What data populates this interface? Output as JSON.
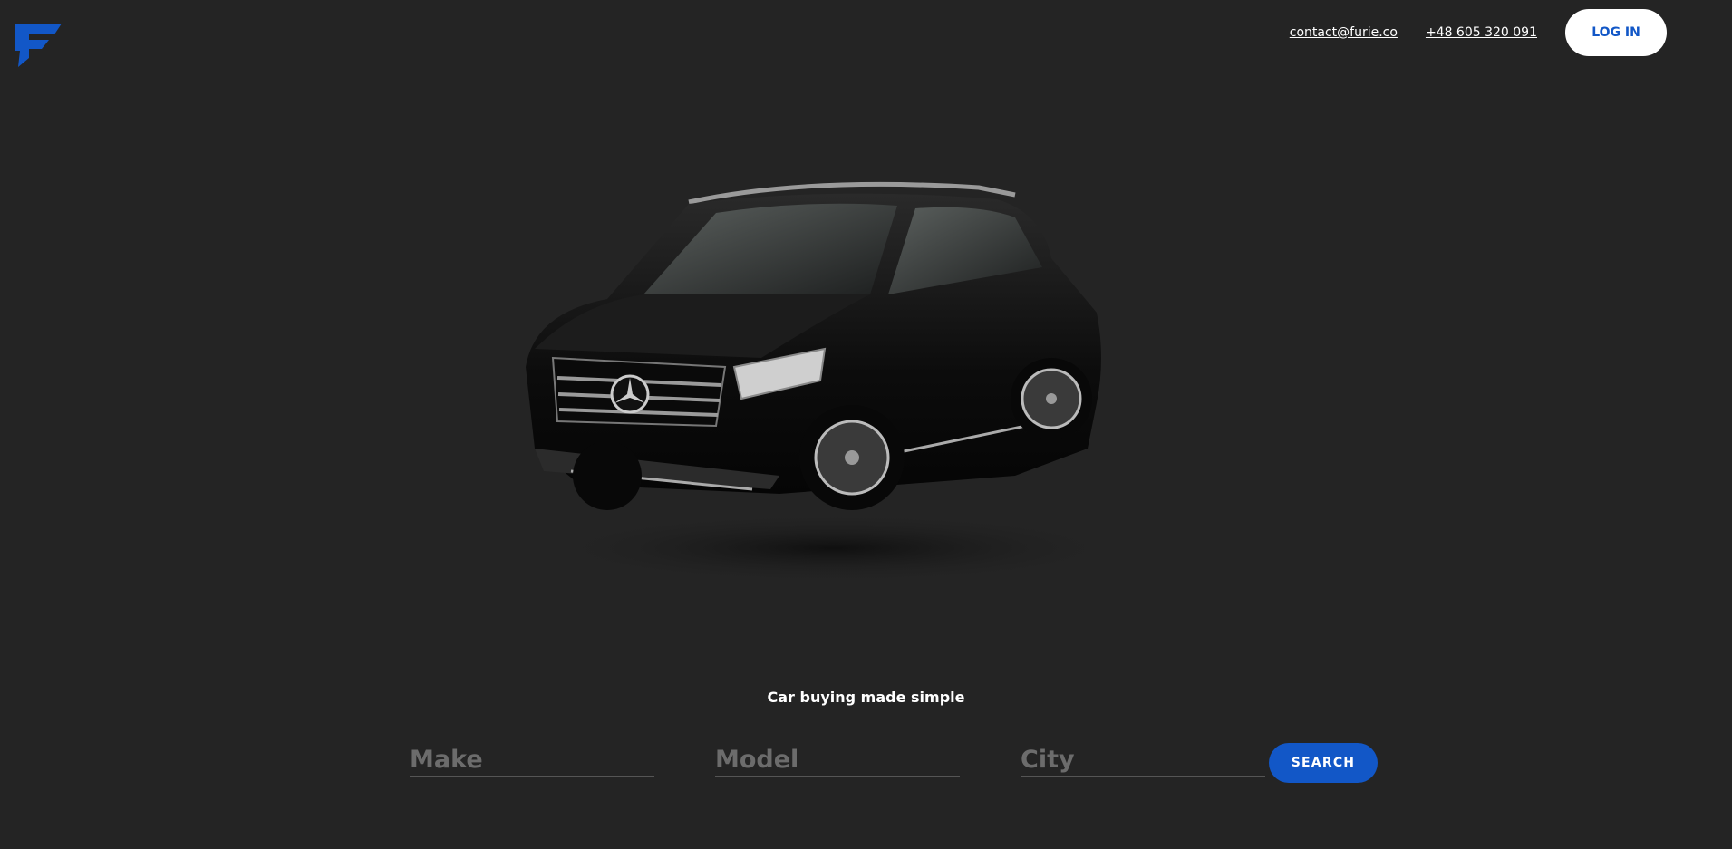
{
  "brand": {
    "accent": "#1257c7",
    "logo_icon": "furie-f-logo-icon"
  },
  "header": {
    "email": "contact@furie.co",
    "phone": "+48 605 320 091",
    "login_label": "LOG IN"
  },
  "hero": {
    "image": "black-suv-image",
    "tagline": "Car buying made simple"
  },
  "search": {
    "make_placeholder": "Make",
    "model_placeholder": "Model",
    "city_placeholder": "City",
    "button_label": "SEARCH"
  }
}
